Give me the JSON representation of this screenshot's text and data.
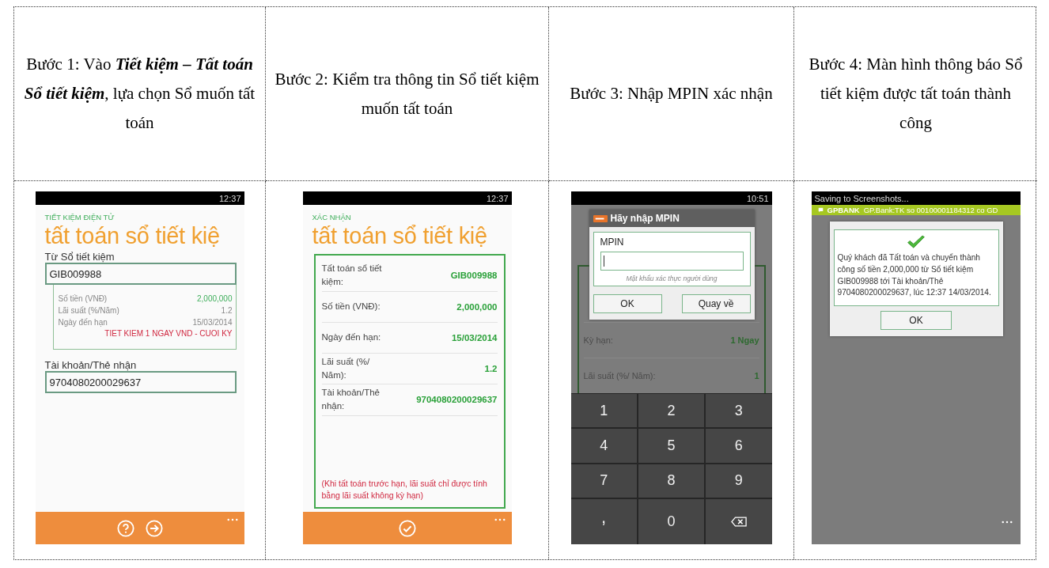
{
  "steps": [
    {
      "caption": "Bước 1: Vào **Tiết kiệm – Tất toán Sổ tiết kiệm**, lựa chọn Sổ muốn tất toán",
      "screen": {
        "kind": "form",
        "time": "12:37",
        "section": "TIẾT KIỆM ĐIỆN TỬ",
        "title": "tất toán sổ tiết kiệ",
        "source_label": "Từ Sổ tiết kiệm",
        "source_value": "GIB009988",
        "details": [
          {
            "label": "Số tiền (VNĐ)",
            "value": "2,000,000",
            "highlight": true
          },
          {
            "label": "Lãi suất (%/Năm)",
            "value": "1.2",
            "highlight": false
          },
          {
            "label": "Ngày đến hạn",
            "value": "15/03/2014",
            "highlight": false
          }
        ],
        "product": "TIET KIEM 1 NGAY VND - CUOI KY",
        "target_label": "Tài khoản/Thẻ nhận",
        "target_value": "9704080200029637"
      }
    },
    {
      "caption": "Bước 2: Kiểm tra thông tin Sổ tiết kiệm muốn tất toán",
      "screen": {
        "kind": "confirm",
        "time": "12:37",
        "section": "XÁC NHẬN",
        "title": "tất toán sổ tiết kiệ",
        "rows": [
          {
            "label": "Tất toán sổ tiết kiệm:",
            "value": "GIB009988"
          },
          {
            "label": "Số tiền (VNĐ):",
            "value": "2,000,000"
          },
          {
            "label": "Ngày đến hạn:",
            "value": "15/03/2014"
          },
          {
            "label": "Lãi suất (%/ Năm):",
            "value": "1.2"
          },
          {
            "label": "Tài khoản/Thẻ nhận:",
            "value": "9704080200029637"
          }
        ],
        "note": "(Khi tất toán trước hạn, lãi suất chỉ được tính bằng lãi suất không kỳ hạn)"
      }
    },
    {
      "caption": "Bước 3: Nhập MPIN xác nhận",
      "screen": {
        "kind": "mpin",
        "time": "10:51",
        "background_rows": [
          {
            "label": "Kỳ hạn:",
            "value": "1 Ngay"
          },
          {
            "label": "Lãi suất (%/ Năm):",
            "value": "1"
          }
        ],
        "dialog_title": "Hãy nhập MPIN",
        "field_label": "MPIN",
        "hint": "Mật khẩu xác thực người dùng",
        "buttons": [
          "OK",
          "Quay về"
        ],
        "keys": [
          {
            "kind": "char",
            "label": "1"
          },
          {
            "kind": "char",
            "label": "2"
          },
          {
            "kind": "char",
            "label": "3"
          },
          {
            "kind": "char",
            "label": "4"
          },
          {
            "kind": "char",
            "label": "5"
          },
          {
            "kind": "char",
            "label": "6"
          },
          {
            "kind": "char",
            "label": "7"
          },
          {
            "kind": "char",
            "label": "8"
          },
          {
            "kind": "char",
            "label": "9"
          },
          {
            "kind": "punct",
            "label": ","
          },
          {
            "kind": "char",
            "label": "0"
          },
          {
            "kind": "backspace"
          }
        ]
      }
    },
    {
      "caption": "Bước 4: Màn hình thông báo Sổ tiết kiệm được tất toán thành công",
      "screen": {
        "kind": "result",
        "status": "Saving to Screenshots...",
        "sender": "GPBANK",
        "notification": "GP.Bank:TK so 00100001184312 co GD",
        "message": "Quý khách đã Tất toán và chuyển thành công số tiền 2,000,000 từ Sổ tiết kiệm GIB009988 tới Tài khoản/Thẻ  9704080200029637, lúc 12:37 14/03/2014.",
        "button": "OK"
      }
    }
  ]
}
